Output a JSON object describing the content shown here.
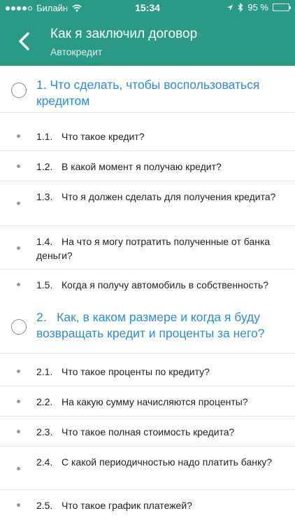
{
  "status": {
    "carrier": "Билайн",
    "time": "15:34",
    "battery": "95 %",
    "battery_level": 0.95
  },
  "header": {
    "title": "Как я заключил договор",
    "subtitle": "Автокредит"
  },
  "sections": [
    {
      "title": "1. Что сделать, чтобы воспользоваться кредитом",
      "items": [
        {
          "num": "1.1.",
          "text": "Что такое кредит?"
        },
        {
          "num": "1.2.",
          "text": "В какой момент я получаю кредит?"
        },
        {
          "num": "1.3.",
          "text": "Что я должен сделать для получения кредита?"
        },
        {
          "num": "1.4.",
          "text": "На что я могу потратить полученные от банка деньги?"
        },
        {
          "num": "1.5.",
          "text": "Когда я получу автомобиль в собственность?"
        }
      ]
    },
    {
      "title": "2.   Как, в каком размере и когда я буду возвращать кредит и проценты за него?",
      "items": [
        {
          "num": "2.1.",
          "text": "Что такое проценты по кредиту?"
        },
        {
          "num": "2.2.",
          "text": "На какую сумму начисляются проценты?"
        },
        {
          "num": "2.3.",
          "text": "Что такое полная стоимость кредита?"
        },
        {
          "num": "2.4.",
          "text": "С какой периодичностью надо платить банку?"
        },
        {
          "num": "2.5.",
          "text": "Что такое график платежей?"
        }
      ]
    }
  ]
}
